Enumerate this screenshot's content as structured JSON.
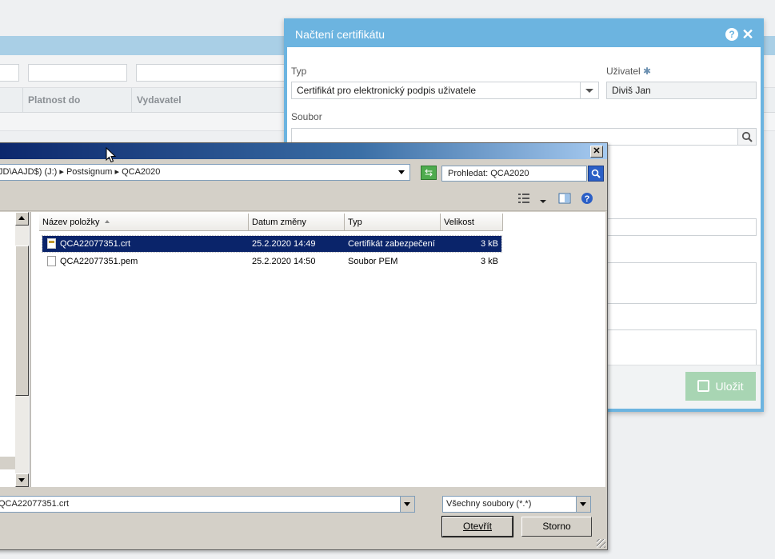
{
  "background": {
    "columns": {
      "valid_to": "Platnost do",
      "issuer": "Vydavatel"
    }
  },
  "modal": {
    "title": "Načtení certifikátu",
    "type_label": "Typ",
    "type_value": "Certifikát pro elektronický podpis uživatele",
    "user_label": "Uživatel",
    "required_mark": "✱",
    "user_value": "Diviš Jan",
    "file_label": "Soubor",
    "save_label": "Uložit"
  },
  "dialog": {
    "address": "JD\\AAJD$) (J:) ▸ Postsignum ▸ QCA2020",
    "search_placeholder": "Prohledat: QCA2020",
    "columns": {
      "name": "Název položky",
      "modified": "Datum změny",
      "type": "Typ",
      "size": "Velikost"
    },
    "files": [
      {
        "name": "QCA22077351.crt",
        "modified": "25.2.2020 14:49",
        "type": "Certifikát zabezpečení",
        "size": "3 kB",
        "selected": true
      },
      {
        "name": "QCA22077351.pem",
        "modified": "25.2.2020 14:50",
        "type": "Soubor PEM",
        "size": "3 kB",
        "selected": false
      }
    ],
    "filename_value": "QCA22077351.crt",
    "filetype_value": "Všechny soubory (*.*)",
    "open_label": "Otevřít",
    "cancel_label": "Storno"
  }
}
